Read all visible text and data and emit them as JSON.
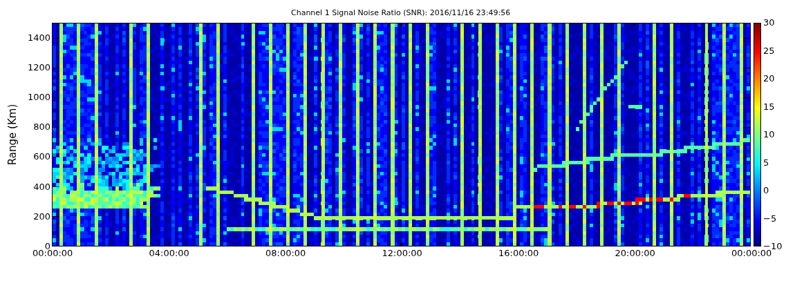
{
  "chart": {
    "title": "Channel 1 Signal Noise Ratio (SNR): 2016/11/16 23:49:56",
    "ylabel": "Range (Km)",
    "yticks": [
      "1400",
      "1200",
      "1000",
      "800",
      "600",
      "400",
      "200",
      "0"
    ],
    "colorbar_ticks": [
      "30",
      "25",
      "20",
      "15",
      "10",
      "5",
      "0",
      "−5",
      "−10"
    ],
    "xticks": [
      "00:00:00",
      "04:00:00",
      "08:00:00",
      "12:00:00",
      "16:00:00",
      "20:00:00",
      "00:00:00"
    ]
  }
}
